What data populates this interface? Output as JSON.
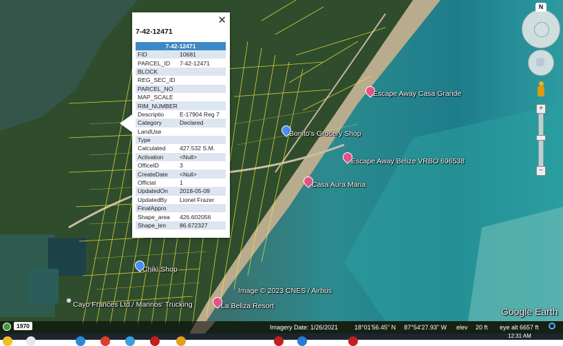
{
  "popup": {
    "title": "7-42-12471",
    "table_header": "7-42-12471",
    "close_label": "✕",
    "rows": [
      {
        "field": "FID",
        "value": "10681"
      },
      {
        "field": "PARCEL_ID",
        "value": "7-42-12471"
      },
      {
        "field": "BLOCK",
        "value": ""
      },
      {
        "field": "REG_SEC_ID",
        "value": ""
      },
      {
        "field": "PARCEL_NO",
        "value": ""
      },
      {
        "field": "MAP_SCALE",
        "value": ""
      },
      {
        "field": "RIM_NUMBER",
        "value": ""
      },
      {
        "field": "Descriptio",
        "value": "E-17904 Reg 7"
      },
      {
        "field": "Category",
        "value": "Declared"
      },
      {
        "field": "LandUse",
        "value": ""
      },
      {
        "field": "Type",
        "value": ""
      },
      {
        "field": "Calculated",
        "value": "427.532 S.M."
      },
      {
        "field": "Activation",
        "value": "<Null>"
      },
      {
        "field": "OfficeID",
        "value": "3"
      },
      {
        "field": "CreateDate",
        "value": "<Null>"
      },
      {
        "field": "Official",
        "value": "1"
      },
      {
        "field": "UpdatedOn",
        "value": "2018-05-09"
      },
      {
        "field": "UpdatedBy",
        "value": "Lionel Frazer"
      },
      {
        "field": "FinalAppro",
        "value": ""
      },
      {
        "field": "Shape_area",
        "value": "426.602056"
      },
      {
        "field": "Shape_len",
        "value": "86.672327"
      }
    ]
  },
  "places": [
    {
      "name": "Escape Away Casa Grande",
      "icon": "pink-pin"
    },
    {
      "name": "Bonito's Grocery Shop",
      "icon": "blue-pin"
    },
    {
      "name": "Escape Away Belize VRBO 696538",
      "icon": "pink-pin"
    },
    {
      "name": "Casa Aura Maria",
      "icon": "pink-pin"
    },
    {
      "name": "Chiki Shop",
      "icon": "blue-pin"
    },
    {
      "name": "Cayo Frances Ltd./ Marinos' Trucking",
      "icon": "none"
    },
    {
      "name": "La Beliza Resort",
      "icon": "pink-pin"
    }
  ],
  "attribution": "Image © 2023 CNES / Airbus",
  "brand": "Google Earth",
  "nav": {
    "north": "N",
    "zoom_in": "+",
    "zoom_out": "−"
  },
  "status": {
    "year": "1970",
    "imagery_date": "Imagery Date: 1/26/2021",
    "lat": "18°01'56.45\" N",
    "lon": "87°54'27.93\" W",
    "elev_label": "elev",
    "elev": "20 ft",
    "eye_alt": "eye alt  6657 ft"
  },
  "taskbar": {
    "clock": "12:31 AM"
  },
  "colors": {
    "parcel_lines": "#f2e840",
    "water": "#1c7a86",
    "popup_header": "#3d88c6",
    "alt_row": "#dde6f0"
  }
}
